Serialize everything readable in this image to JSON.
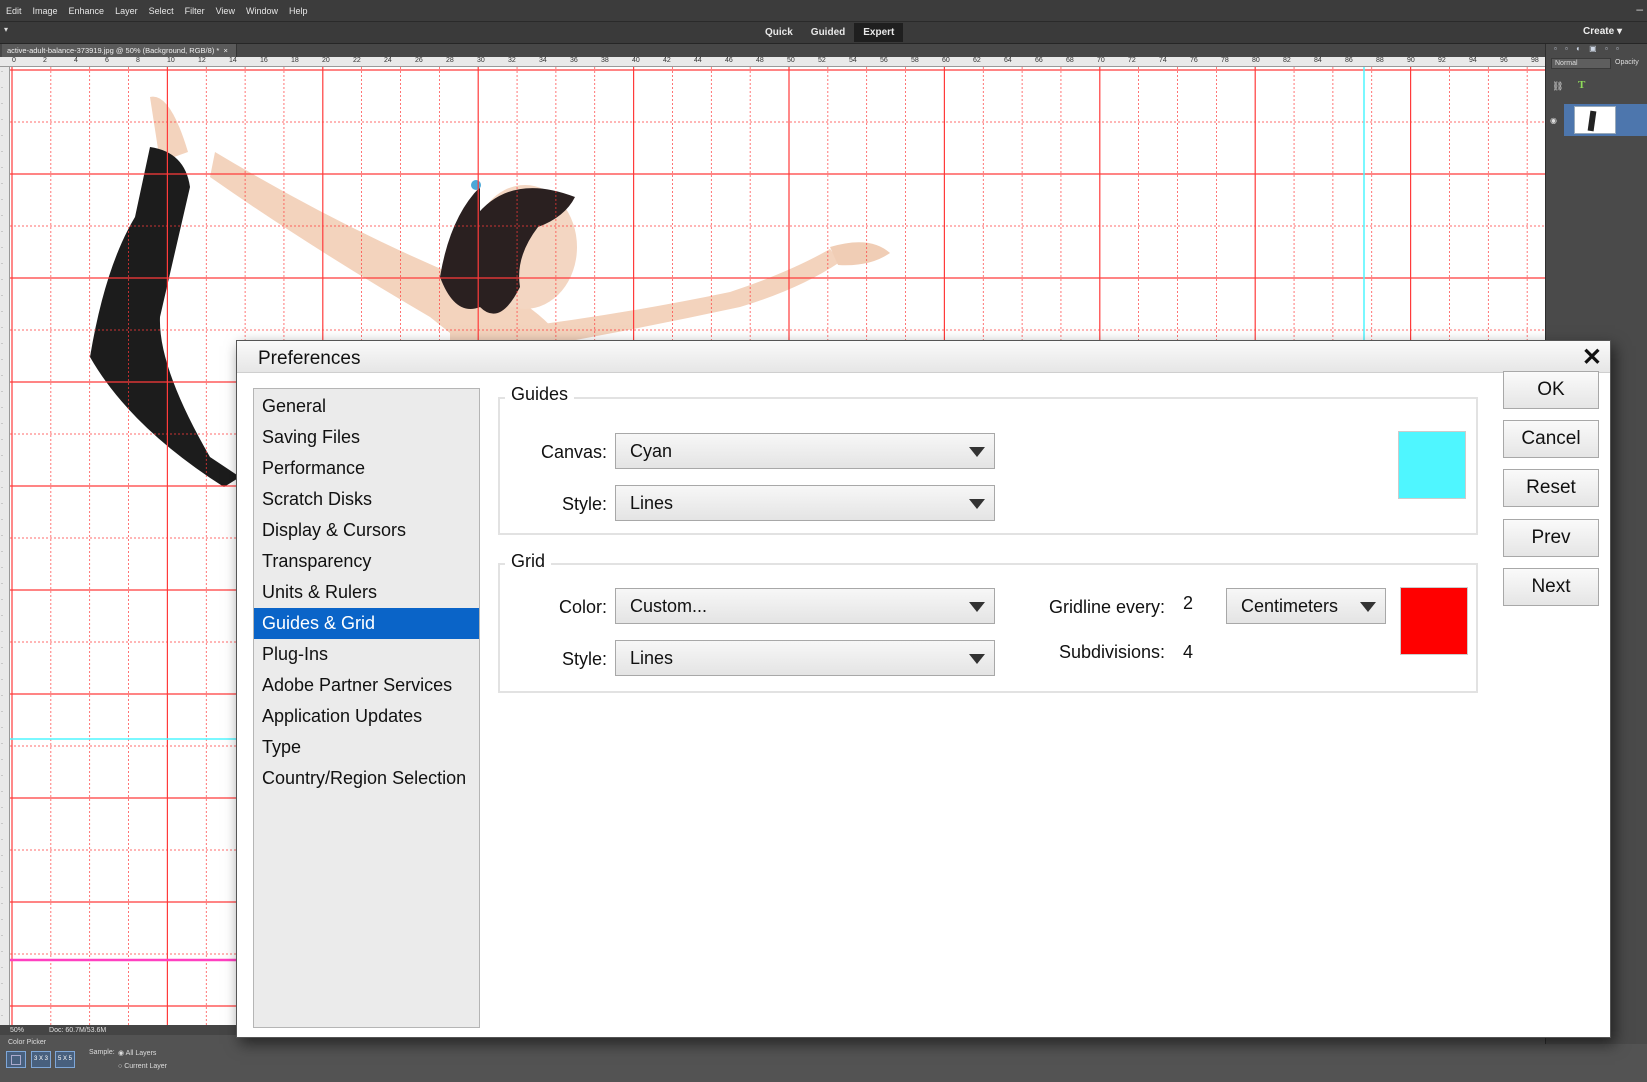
{
  "menu": [
    "Edit",
    "Image",
    "Enhance",
    "Layer",
    "Select",
    "Filter",
    "View",
    "Window",
    "Help"
  ],
  "modes": [
    "Quick",
    "Guided",
    "Expert"
  ],
  "active_mode": "Expert",
  "create_label": "Create",
  "document_tab": "active-adult-balance-373919.jpg @ 50% (Background, RGB/8) *",
  "hruler_labels": [
    "0",
    "2",
    "4",
    "6",
    "8",
    "10",
    "12",
    "14",
    "16",
    "18",
    "20",
    "22",
    "24",
    "26",
    "28",
    "30",
    "32",
    "34",
    "36",
    "38",
    "40",
    "42",
    "44",
    "46",
    "48",
    "50",
    "52",
    "54",
    "56",
    "58",
    "60",
    "62",
    "64",
    "66",
    "68",
    "70",
    "72",
    "74",
    "76",
    "78",
    "80",
    "82",
    "84",
    "86",
    "88",
    "90",
    "92",
    "94",
    "96",
    "98"
  ],
  "right_panel": {
    "blend_mode": "Normal",
    "opacity_label": "Opacity"
  },
  "status": {
    "zoom": "50%",
    "doc": "Doc: 60.7M/53.6M"
  },
  "tool_options": {
    "title": "Color Picker",
    "sizes": [
      "3 X 3",
      "5 X 5"
    ],
    "sample_label": "Sample:",
    "sample_all": "All Layers",
    "sample_current": "Current Layer"
  },
  "dialog": {
    "title": "Preferences",
    "categories": [
      "General",
      "Saving Files",
      "Performance",
      "Scratch Disks",
      "Display & Cursors",
      "Transparency",
      "Units & Rulers",
      "Guides & Grid",
      "Plug-Ins",
      "Adobe Partner Services",
      "Application Updates",
      "Type",
      "Country/Region Selection"
    ],
    "selected_category": "Guides & Grid",
    "guides": {
      "legend": "Guides",
      "canvas_label": "Canvas:",
      "canvas_value": "Cyan",
      "style_label": "Style:",
      "style_value": "Lines",
      "color": "#4ff6ff"
    },
    "grid": {
      "legend": "Grid",
      "color_label": "Color:",
      "color_value": "Custom...",
      "style_label": "Style:",
      "style_value": "Lines",
      "gridline_label": "Gridline every:",
      "gridline_value": "2",
      "subdivisions_label": "Subdivisions:",
      "subdivisions_value": "4",
      "unit_value": "Centimeters",
      "color": "#ff0000"
    },
    "buttons": {
      "ok": "OK",
      "cancel": "Cancel",
      "reset": "Reset",
      "prev": "Prev",
      "next": "Next"
    }
  },
  "colors": {
    "grid_line": "#ff3b3b",
    "guide_line": "#4ff6ff",
    "selection": "#0a64c8"
  }
}
